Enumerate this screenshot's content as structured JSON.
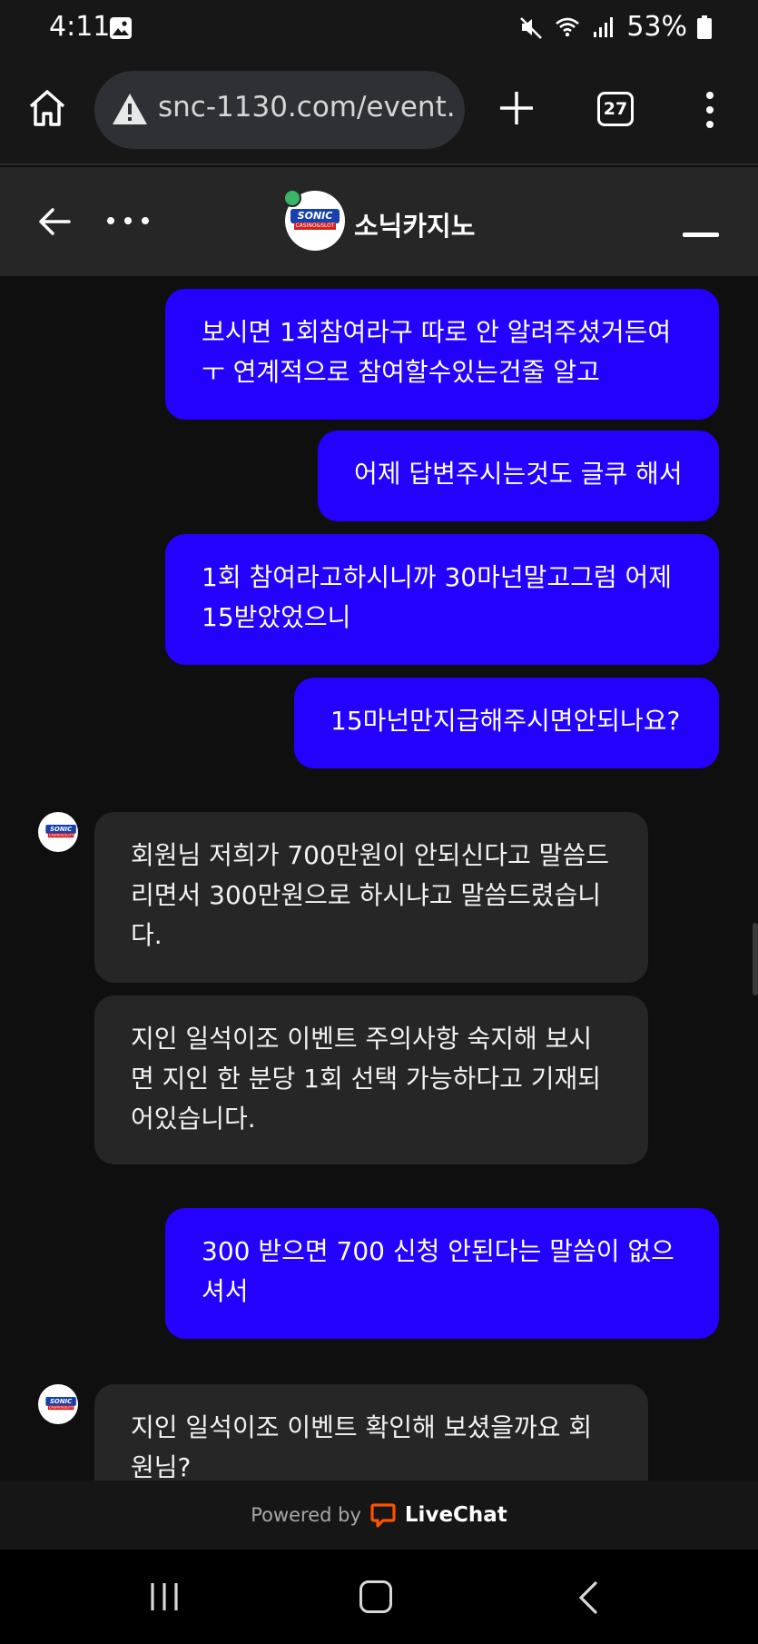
{
  "status_bar": {
    "time": "4:11",
    "battery": "53%",
    "icons": [
      "gallery-icon",
      "mute-icon",
      "wifi-icon",
      "signal-icon",
      "battery-icon"
    ]
  },
  "browser": {
    "url": "snc-1130.com/event.",
    "tab_count": "27",
    "icons": [
      "home-icon",
      "warning-icon",
      "plus-icon",
      "tabs-icon",
      "menu-icon"
    ]
  },
  "chat_header": {
    "agent_name": "소닉카지노",
    "logo_text": "SONIC",
    "logo_sub": "CASINO&SLOT",
    "icons": [
      "back-arrow-icon",
      "more-dots-icon",
      "minimize-icon"
    ]
  },
  "messages": [
    {
      "from": "user",
      "lines": [
        "보시면 1회참여라구 따로 안 알려주셨거든여",
        "ㅜ 연계적으로 참여할수있는건줄 알고"
      ]
    },
    {
      "from": "user",
      "lines": [
        "어제 답변주시는것도 글쿠 해서"
      ]
    },
    {
      "from": "user",
      "lines": [
        "1회 참여라고하시니까 30마넌말고그럼 어제",
        "15받았었으니"
      ]
    },
    {
      "from": "user",
      "lines": [
        "15마넌만지급해주시면안되나요?"
      ]
    },
    {
      "from": "agent",
      "lines": [
        "회원님 저희가 700만원이 안되신다고 말씀드",
        "리면서 300만원으로 하시냐고 말씀드렸습니",
        "다."
      ]
    },
    {
      "from": "agent",
      "lines": [
        "지인 일석이조 이벤트 주의사항 숙지해 보시",
        "면 지인 한 분당 1회 선택 가능하다고 기재되",
        "어있습니다."
      ]
    },
    {
      "from": "user",
      "lines": [
        "300 받으면 700 신청 안된다는 말씀이 없으",
        "셔서"
      ]
    },
    {
      "from": "agent",
      "lines": [
        "지인 일석이조 이벤트 확인해 보셨을까요 회",
        "원님?"
      ]
    }
  ],
  "footer": {
    "powered_label": "Powered by",
    "brand": "LiveChat",
    "brand_color": "#ff5100"
  },
  "nav_bar": {
    "icons": [
      "recents-icon",
      "home-circle-icon",
      "back-chevron-icon"
    ]
  },
  "colors": {
    "user_bubble": "#2400ff",
    "agent_bubble": "#262626",
    "background": "#0f0f0f",
    "online": "#39b56a"
  }
}
